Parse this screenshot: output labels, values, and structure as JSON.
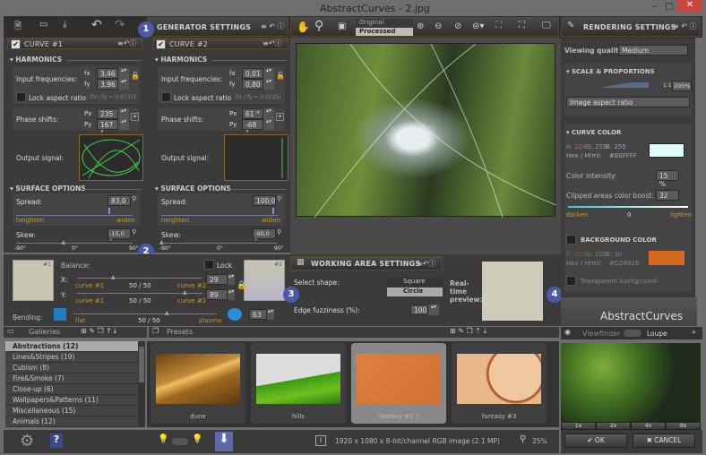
{
  "window": {
    "title": "AbstractCurves - 2.jpg",
    "minimize": "–",
    "maximize": "□",
    "close": "✕"
  },
  "generator": {
    "title": "GENERATOR SETTINGS"
  },
  "curves": [
    {
      "title": "CURVE #1",
      "harmonics": "HARMONICS",
      "input_freq_label": "Input frequencies:",
      "fx_label": "fx",
      "fy_label": "fy",
      "fx": "3,46",
      "fy": "3,96",
      "lock_label": "Lock aspect ratio",
      "ratio": "(fx / fy = 0.8737)",
      "phase_label": "Phase shifts:",
      "px_label": "Px",
      "py_label": "Py",
      "px": "235 °",
      "py": "167 °",
      "output_label": "Output signal:",
      "surface": "SURFACE OPTIONS",
      "spread_label": "Spread:",
      "spread": "83,0",
      "heighten": "heighten",
      "widen": "widen",
      "skew_label": "Skew:",
      "skew": "-15,0 °",
      "skew_min": "-90°",
      "skew_mid": "0°",
      "skew_max": "90°",
      "spread_level": 0.83,
      "skew_level": -15
    },
    {
      "title": "CURVE #2",
      "harmonics": "HARMONICS",
      "input_freq_label": "Input frequencies:",
      "fx_label": "fx",
      "fy_label": "fy",
      "fx": "0,01",
      "fy": "0,80",
      "lock_label": "Lock aspect ratio",
      "ratio": "(fx / fy = 0.0125)",
      "phase_label": "Phase shifts:",
      "px_label": "Px",
      "py_label": "Py",
      "px": "61 °",
      "py": "-68 °",
      "output_label": "Output signal:",
      "surface": "SURFACE OPTIONS",
      "spread_label": "Spread:",
      "spread": "100,0",
      "heighten": "heighten",
      "widen": "widen",
      "skew_label": "Skew:",
      "skew": "-90,0 °",
      "skew_min": "-90°",
      "skew_mid": "0°",
      "skew_max": "90°",
      "spread_level": 1.0,
      "skew_level": -90
    }
  ],
  "balance": {
    "label": "Balance:",
    "lock": "Lock",
    "x_label": "X:",
    "y_label": "Y:",
    "curve1": "curve #1",
    "curve2": "curve #2",
    "mid": "50 / 50",
    "x": "29",
    "y": "89",
    "thumb1": "#1",
    "thumb2": "#2"
  },
  "bending": {
    "label": "Bending:",
    "flat": "flat",
    "plasma": "plasma",
    "mid": "50 / 50",
    "value": "63"
  },
  "steps": [
    "1",
    "2",
    "3",
    "4"
  ],
  "view_toolbar": {
    "original": "Original",
    "processed": "Processed",
    "active": "Processed"
  },
  "working_area": {
    "title": "WORKING AREA SETTINGS",
    "shape_label": "Select shape:",
    "square": "Square",
    "circle": "Circle",
    "selected": "Circle",
    "fuzz_label": "Edge fuzziness (%):",
    "fuzz": "100",
    "preview_label": "Real-time preview:"
  },
  "rendering": {
    "title": "RENDERING SETTINGS",
    "quality_label": "Viewing quality:",
    "quality": "Medium",
    "scale_title": "SCALE & PROPORTIONS",
    "one_to_one": "1:1",
    "scale": "200%",
    "aspect": "Image aspect ratio",
    "curve_color_title": "CURVE COLOR",
    "r": "R: 224",
    "g": "G: 255",
    "b": "B: 255",
    "hex_label": "Hex / Html:",
    "hex": "#E0FFFF",
    "intensity_label": "Color intensity:",
    "intensity": "15 %",
    "boost_label": "Clipped areas color boost:",
    "boost": "32",
    "darken": "darken",
    "zero": "0",
    "lighten": "lighten",
    "bg_title": "BACKGROUND COLOR",
    "bg_r": "R: 210",
    "bg_g": "G: 105",
    "bg_b": "B: 30",
    "bg_hex": "#D2691E",
    "transparent": "Transparent background",
    "curve_color": "#E0FFFF",
    "bg_color": "#D2691E"
  },
  "logo": "AbstractCurves",
  "galleries": {
    "title": "Galleries",
    "items": [
      "Abstractions (12)",
      "Lines&Stripes (19)",
      "Cubism (8)",
      "Fire&Smoke (7)",
      "Close-up (6)",
      "Wallpapers&Patterns (11)",
      "Miscellaneous (15)",
      "Animals (12)"
    ],
    "selected": "Abstractions (12)"
  },
  "presets": {
    "title": "Presets",
    "items": [
      "dune",
      "hills",
      "fantasy #2 *",
      "fantasy #3"
    ],
    "selected": "fantasy #2 *"
  },
  "viewfinder": {
    "title": "Viewfinder",
    "loupe": "Loupe",
    "zooms": [
      "1x",
      "2x",
      "4x",
      "8x"
    ]
  },
  "status": {
    "info": "1920 x 1080 x 8-bit/channel RGB image  (2.1 MP)",
    "zoom": "25%"
  },
  "buttons": {
    "ok": "OK",
    "cancel": "CANCEL"
  }
}
